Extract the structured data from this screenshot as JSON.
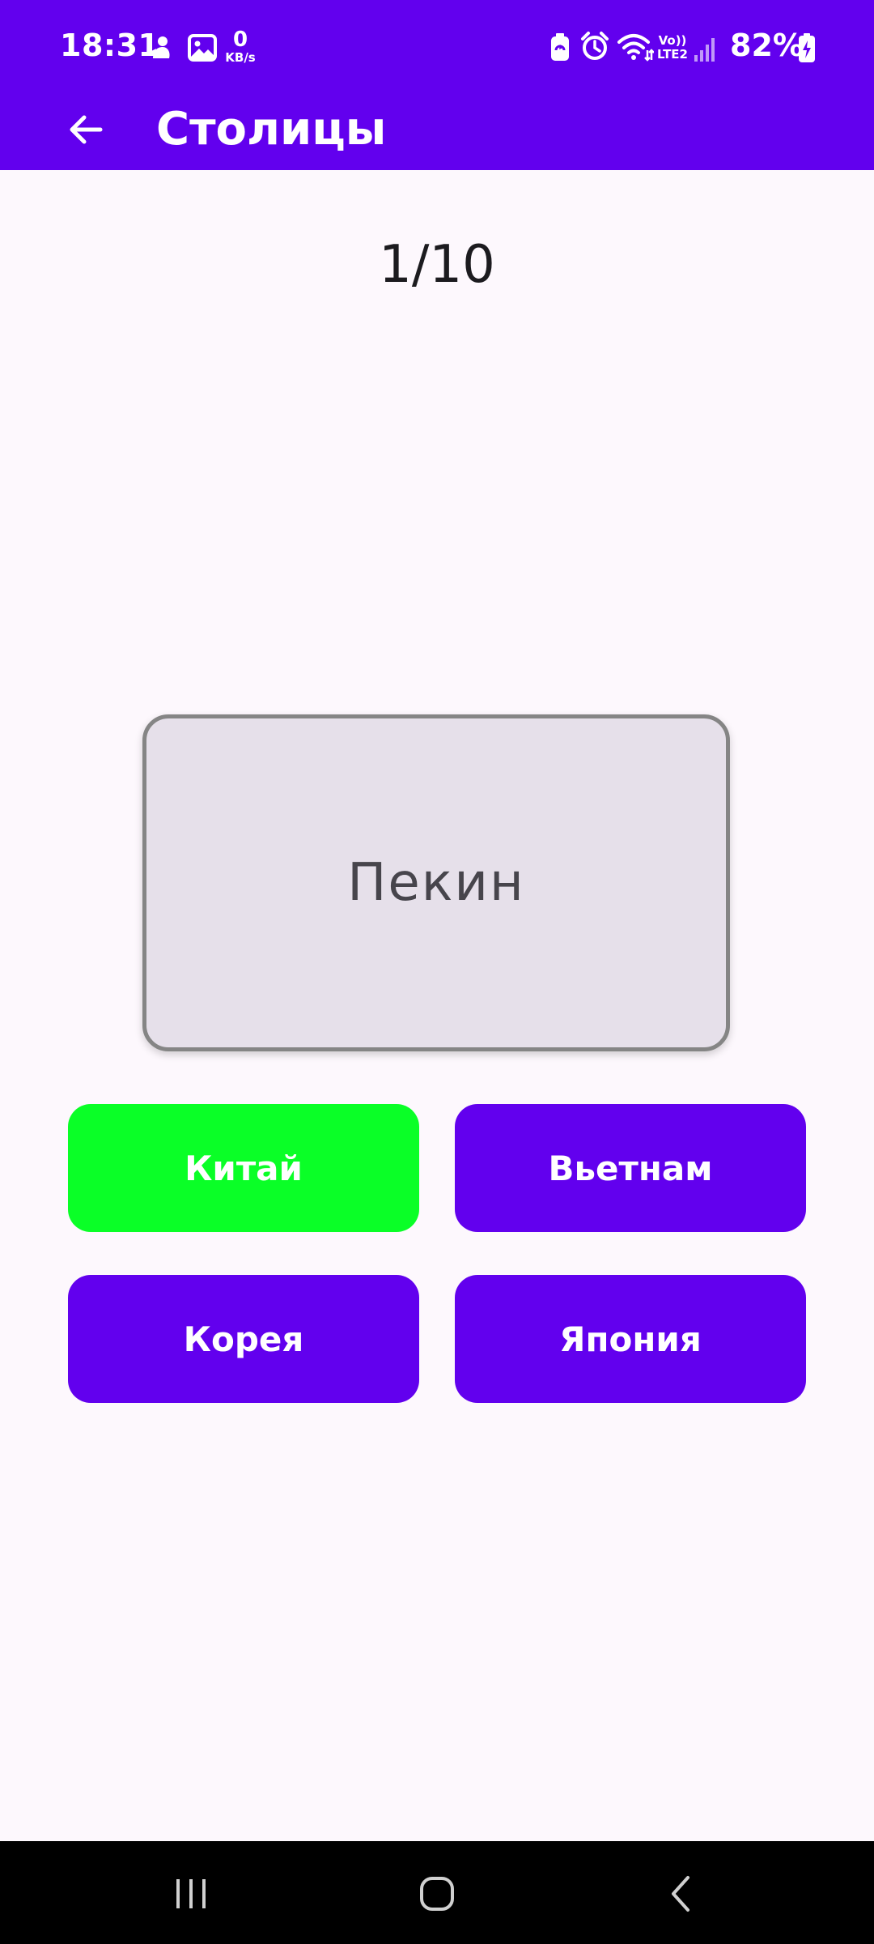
{
  "status_bar": {
    "time": "18:31",
    "net_speed_value": "0",
    "net_speed_unit": "KB/s",
    "volte_top": "Vo))",
    "volte_bottom": "LTE2",
    "battery": "82%",
    "icons": [
      "notification-icon",
      "gallery-icon",
      "battery-saver-icon",
      "alarm-icon",
      "wifi-icon",
      "signal-icon",
      "battery-charging-icon"
    ]
  },
  "app_bar": {
    "title": "Столицы",
    "back_icon": "arrow-back-icon"
  },
  "quiz": {
    "counter": "1/10",
    "question": "Пекин",
    "answers": [
      {
        "label": "Китай",
        "state": "correct"
      },
      {
        "label": "Вьетнам",
        "state": "default"
      },
      {
        "label": "Корея",
        "state": "default"
      },
      {
        "label": "Япония",
        "state": "default"
      }
    ]
  },
  "nav_bar": {
    "buttons": [
      "recents-icon",
      "home-icon",
      "back-icon"
    ]
  },
  "colors": {
    "primary": "#6200ee",
    "correct": "#0aff27",
    "card_bg": "#e6e0ea",
    "card_border": "#858585",
    "background": "#fdf8fd"
  }
}
